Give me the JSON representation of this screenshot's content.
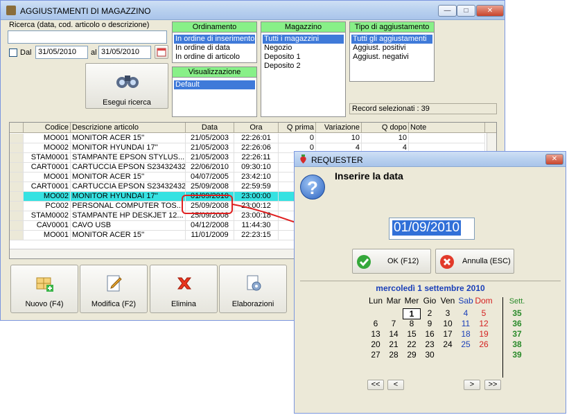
{
  "main": {
    "title": "AGGIUSTAMENTI DI MAGAZZINO",
    "search_label": "Ricerca (data, cod. articolo o descrizione)",
    "search_value": "",
    "dal_label": "Dal",
    "date_from": "31/05/2010",
    "al_label": "al",
    "date_to": "31/05/2010",
    "search_button": "Esegui ricerca",
    "ordinamento": {
      "header": "Ordinamento",
      "items": [
        "In ordine di inserimento",
        "In ordine di data",
        "In ordine di articolo"
      ]
    },
    "visualizzazione": {
      "header": "Visualizzazione",
      "items": [
        "Default"
      ]
    },
    "magazzino": {
      "header": "Magazzino",
      "items": [
        "Tutti i magazzini",
        "Negozio",
        "Deposito 1",
        "Deposito 2"
      ]
    },
    "tipo": {
      "header": "Tipo di aggiustamento",
      "items": [
        "Tutti gli aggiustamenti",
        "Aggiust. positivi",
        "Aggiust. negativi"
      ]
    },
    "record_count": "Record selezionati : 39",
    "columns": [
      "Codice",
      "Descrizione articolo",
      "Data",
      "Ora",
      "Q prima",
      "Variazione",
      "Q dopo",
      "Note"
    ],
    "rows": [
      [
        "MO001",
        "MONITOR ACER 15''",
        "21/05/2003",
        "22:26:01",
        "0",
        "10",
        "10",
        ""
      ],
      [
        "MO002",
        "MONITOR HYUNDAI 17''",
        "21/05/2003",
        "22:26:06",
        "0",
        "4",
        "4",
        ""
      ],
      [
        "STAM0001",
        "STAMPANTE EPSON STYLUS...",
        "21/05/2003",
        "22:26:11",
        "",
        "",
        "",
        ""
      ],
      [
        "CART0001",
        "CARTUCCIA EPSON S23432432",
        "22/06/2010",
        "09:30:10",
        "",
        "",
        "",
        ""
      ],
      [
        "MO001",
        "MONITOR ACER 15''",
        "04/07/2005",
        "23:42:10",
        "",
        "",
        "",
        ""
      ],
      [
        "CART0001",
        "CARTUCCIA EPSON S23432432",
        "25/09/2008",
        "22:59:59",
        "",
        "",
        "",
        ""
      ],
      [
        "MO002",
        "MONITOR HYUNDAI 17''",
        "01/09/2010",
        "23:00:00",
        "",
        "",
        "",
        ""
      ],
      [
        "PC002",
        "PERSONAL COMPUTER TOS...",
        "25/09/2008",
        "23:00:12",
        "",
        "",
        "",
        ""
      ],
      [
        "STAM0002",
        "STAMPANTE HP DESKJET 12...",
        "25/09/2008",
        "23:00:18",
        "",
        "",
        "",
        ""
      ],
      [
        "CAV0001",
        "CAVO USB",
        "04/12/2008",
        "11:44:30",
        "",
        "",
        "",
        ""
      ],
      [
        "MO001",
        "MONITOR ACER 15''",
        "11/01/2009",
        "22:23:15",
        "",
        "",
        "",
        ""
      ]
    ],
    "buttons": [
      "Nuovo (F4)",
      "Modifica (F2)",
      "Elimina",
      "Elaborazioni"
    ]
  },
  "requester": {
    "title": "REQUESTER",
    "prompt": "Inserire la data",
    "date_value": "01/09/2010",
    "ok_label": "OK (F12)",
    "cancel_label": "Annulla (ESC)",
    "calendar": {
      "heading": "mercoledì 1 settembre 2010",
      "weekdays": [
        "Lun",
        "Mar",
        "Mer",
        "Gio",
        "Ven",
        "Sab",
        "Dom"
      ],
      "week_header": "Sett.",
      "weeks": [
        {
          "week": "35",
          "days": [
            "",
            "",
            "1",
            "2",
            "3",
            "4",
            "5"
          ]
        },
        {
          "week": "36",
          "days": [
            "6",
            "7",
            "8",
            "9",
            "10",
            "11",
            "12"
          ]
        },
        {
          "week": "37",
          "days": [
            "13",
            "14",
            "15",
            "16",
            "17",
            "18",
            "19"
          ]
        },
        {
          "week": "38",
          "days": [
            "20",
            "21",
            "22",
            "23",
            "24",
            "25",
            "26"
          ]
        },
        {
          "week": "39",
          "days": [
            "27",
            "28",
            "29",
            "30",
            "",
            "",
            ""
          ]
        }
      ],
      "nav": [
        "<<",
        "<",
        ">",
        ">>"
      ]
    }
  }
}
